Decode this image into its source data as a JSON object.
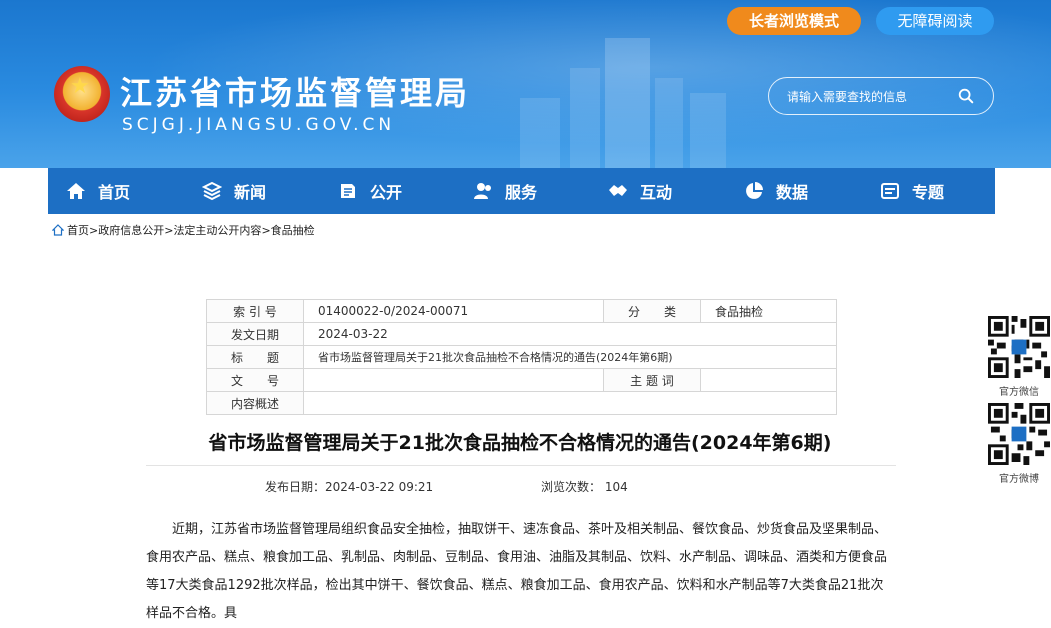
{
  "header": {
    "site_title": "江苏省市场监督管理局",
    "site_domain": "SCJGJ.JIANGSU.GOV.CN",
    "elder_mode_label": "长者浏览模式",
    "accessibility_label": "无障碍阅读",
    "search_placeholder": "请输入需要查找的信息"
  },
  "nav": {
    "items": [
      {
        "label": "首页",
        "icon": "home-icon"
      },
      {
        "label": "新闻",
        "icon": "news-icon"
      },
      {
        "label": "公开",
        "icon": "open-icon"
      },
      {
        "label": "服务",
        "icon": "service-icon"
      },
      {
        "label": "互动",
        "icon": "interact-icon"
      },
      {
        "label": "数据",
        "icon": "data-icon"
      },
      {
        "label": "专题",
        "icon": "topic-icon"
      }
    ]
  },
  "breadcrumb": {
    "items": [
      "首页",
      "政府信息公开",
      "法定主动公开内容",
      "食品抽检"
    ],
    "separator": ">"
  },
  "meta": {
    "index_label": "索 引 号",
    "index_value": "01400022-0/2024-00071",
    "category_label": "分　　类",
    "category_value": "食品抽检",
    "date_label": "发文日期",
    "date_value": "2024-03-22",
    "title_label": "标　　题",
    "title_value": "省市场监督管理局关于21批次食品抽检不合格情况的通告(2024年第6期)",
    "docno_label": "文　　号",
    "docno_value": "",
    "keywords_label": "主 题 词",
    "keywords_value": "",
    "summary_label": "内容概述",
    "summary_value": ""
  },
  "article": {
    "title": "省市场监督管理局关于21批次食品抽检不合格情况的通告(2024年第6期)",
    "publish_label": "发布日期：",
    "publish_value": "2024-03-22 09:21",
    "views_label": "浏览次数：",
    "views_value": "104",
    "paragraph": "近期，江苏省市场监督管理局组织食品安全抽检，抽取饼干、速冻食品、茶叶及相关制品、餐饮食品、炒货食品及坚果制品、食用农产品、糕点、粮食加工品、乳制品、肉制品、豆制品、食用油、油脂及其制品、饮料、水产制品、调味品、酒类和方便食品等17大类食品1292批次样品，检出其中饼干、餐饮食品、糕点、粮食加工品、食用农产品、饮料和水产制品等7大类食品21批次样品不合格。具"
  },
  "sidebar": {
    "wechat_label": "官方微信",
    "weibo_label": "官方微博"
  },
  "colors": {
    "header_blue": "#1b77cf",
    "nav_blue": "#1d6fc4",
    "elder_orange": "#f08a1c",
    "access_blue": "#2f9bf0"
  }
}
